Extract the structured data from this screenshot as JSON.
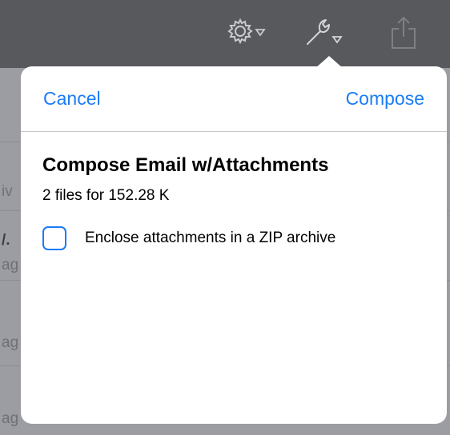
{
  "toolbar": {
    "icons": [
      "gear-menu-icon",
      "wrench-menu-icon",
      "share-icon"
    ]
  },
  "background_list": {
    "fragments": [
      "iv",
      "/.",
      "ag",
      "ag",
      "ag"
    ]
  },
  "popover": {
    "cancel_label": "Cancel",
    "compose_label": "Compose",
    "title": "Compose Email w/Attachments",
    "subtitle": "2 files for 152.28 K",
    "zip_option": {
      "label": "Enclose attachments in a ZIP archive",
      "checked": false
    }
  },
  "colors": {
    "accent": "#1a7cf5",
    "toolbar": "#57595d",
    "dim_background": "#9b9da2"
  }
}
